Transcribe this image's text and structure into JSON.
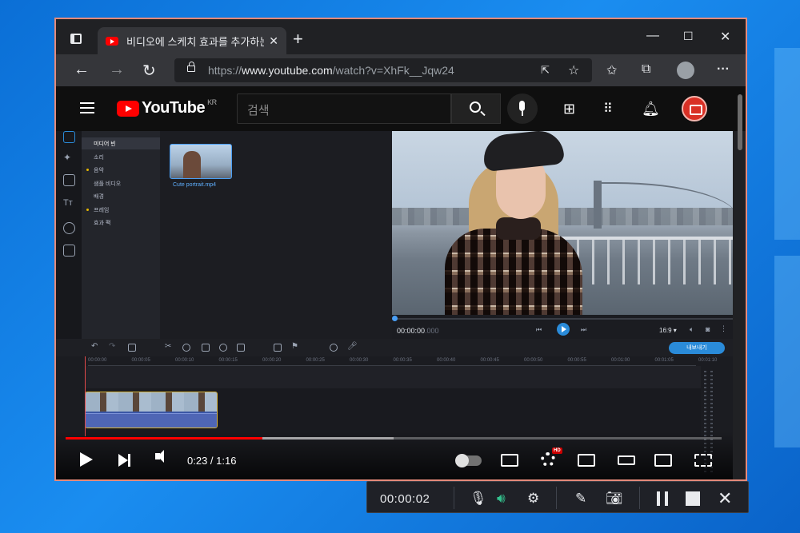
{
  "browser": {
    "tab_title": "비디오에 스케치 효과를 추가하는",
    "tab_close": "✕",
    "new_tab": "+",
    "url_prefix": "https://",
    "url_host": "www.youtube.com",
    "url_path": "/watch?v=XhFk__Jqw24",
    "window_controls": [
      "—",
      "☐",
      "✕"
    ]
  },
  "youtube": {
    "logo_text": "YouTube",
    "region": "KR",
    "search_placeholder": "검색"
  },
  "editor": {
    "panel_items": [
      {
        "label": "미디어 빈",
        "dot": false,
        "selected": true
      },
      {
        "label": "소리",
        "dot": false,
        "selected": false
      },
      {
        "label": "음악",
        "dot": true,
        "selected": false
      },
      {
        "label": "샘플 비디오",
        "dot": false,
        "selected": false
      },
      {
        "label": "배경",
        "dot": false,
        "selected": false
      },
      {
        "label": "프레임",
        "dot": true,
        "selected": false
      },
      {
        "label": "효과 팩",
        "dot": false,
        "selected": false
      }
    ],
    "media_file": "Cute portrait.mp4",
    "preview_time": "00:00:00",
    "preview_time_ms": ".000",
    "aspect_ratio": "16:9 ▾",
    "export_label": "내보내기",
    "ruler_ticks": [
      "00:00:00",
      "00:00:05",
      "00:00:10",
      "00:00:15",
      "00:00:20",
      "00:00:25",
      "00:00:30",
      "00:00:35",
      "00:00:40",
      "00:00:45",
      "00:00:50",
      "00:00:55",
      "00:01:00",
      "00:01:05",
      "00:01:10"
    ]
  },
  "player": {
    "current_time": "0:23",
    "duration": "1:16",
    "played_fraction": 0.3,
    "loaded_fraction": 0.5,
    "hd_badge": "HD"
  },
  "recorder": {
    "elapsed": "00:00:02"
  },
  "colors": {
    "accent_red": "#ff0000",
    "editor_blue": "#2a8bd9",
    "recorder_green": "#34c38f"
  }
}
